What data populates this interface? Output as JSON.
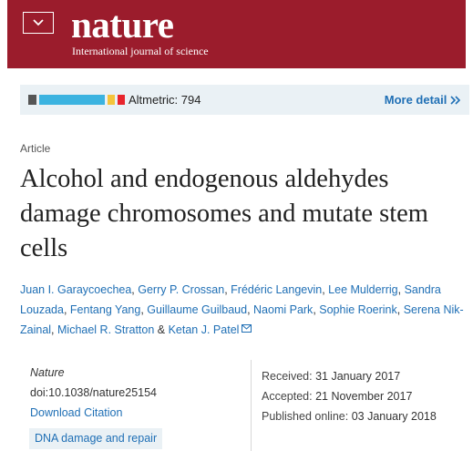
{
  "header": {
    "logo": "nature",
    "tagline": "International journal of science",
    "menu_icon": "chevron-down-icon",
    "background": "#9b1c2c"
  },
  "altmetric": {
    "label": "Altmetric: 794",
    "more_label": "More detail",
    "more_icon": "double-chevron-right-icon",
    "colors": [
      "#555555",
      "#3bb3e0",
      "#3bb3e0",
      "#f4c43b",
      "#e8242c"
    ]
  },
  "article": {
    "type": "Article",
    "title": "Alcohol and endogenous aldehydes damage chromosomes and mutate stem cells",
    "authors": [
      "Juan I. Garaycoechea",
      "Gerry P. Crossan",
      "Frédéric Langevin",
      "Lee Mulderrig",
      "Sandra Louzada",
      "Fentang Yang",
      "Guillaume Guilbaud",
      "Naomi Park",
      "Sophie Roerink",
      "Serena Nik-Zainal",
      "Michael R. Stratton",
      "Ketan J. Patel"
    ],
    "separator": ", ",
    "last_separator": " & ",
    "contact_icon": "mail-icon"
  },
  "meta": {
    "journal": "Nature",
    "doi": "doi:10.1038/nature25154",
    "citation_label": "Download Citation",
    "subject": "DNA damage and repair",
    "received_label": "Received:",
    "received": "31 January 2017",
    "accepted_label": "Accepted:",
    "accepted": "21 November 2017",
    "published_label": "Published online:",
    "published": "03 January 2018"
  }
}
